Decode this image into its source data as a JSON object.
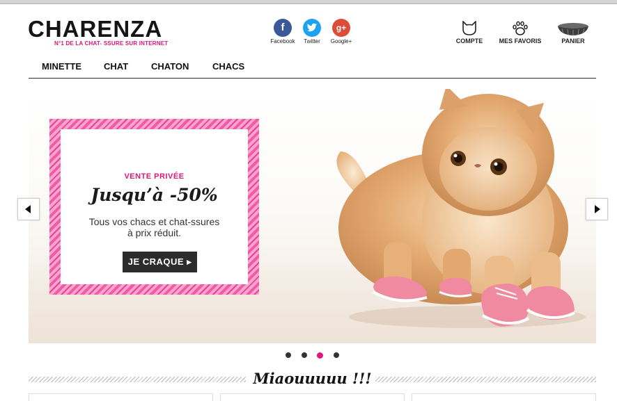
{
  "header": {
    "logo_text": "CHARENZA",
    "tagline": "N°1 DE LA CHAT- SSURE SUR INTERNET"
  },
  "social": [
    {
      "name": "Facebook",
      "glyph": "f",
      "color": "#3b5998"
    },
    {
      "name": "Twitter",
      "glyph": "t",
      "color": "#1da1f2"
    },
    {
      "name": "Google+",
      "glyph": "g+",
      "color": "#dd4b39"
    }
  ],
  "account": {
    "compte": "COMPTE",
    "favoris": "MES FAVORIS",
    "panier": "PANIER"
  },
  "nav": [
    "MINETTE",
    "CHAT",
    "CHATON",
    "CHACS"
  ],
  "promo": {
    "kicker": "VENTE PRIVÉE",
    "title": "Jusqu’à -50%",
    "line1": "Tous vos chacs et chat-ssures",
    "line2": "à prix réduit.",
    "button": "JE CRAQUE"
  },
  "carousel": {
    "slides": 4,
    "active_slide": 3
  },
  "section": {
    "title": "Miaouuuuu !!!"
  },
  "colors": {
    "accent": "#e0157a",
    "dark": "#2c2c2c"
  }
}
